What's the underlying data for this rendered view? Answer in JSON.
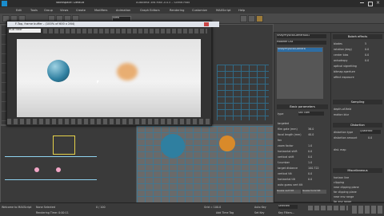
{
  "window": {
    "title": "Autodesk 3ds Max 2015 – Scene.max",
    "tab": "Workspace: Default"
  },
  "menu": [
    "Edit",
    "Tools",
    "Group",
    "Views",
    "Create",
    "Modifiers",
    "Animation",
    "Graph Editors",
    "Rendering",
    "Customize",
    "MAXScript",
    "Help"
  ],
  "toolbar": {
    "view_dropdown": "View"
  },
  "frame_buffer": {
    "title": "F-Top, frame buffer - (100% of 600 x 264)",
    "channel_dropdown": "RGB color"
  },
  "modify_panel": {
    "object_name": "VRayPhysicalCamera001",
    "modifier_list": "Modifier List",
    "stack_item": "VRayPhysicalCamera",
    "rollout_basic": "Basic parameters",
    "type_label": "type",
    "type_value": "Still cam",
    "params": [
      {
        "label": "targeted",
        "value": ""
      },
      {
        "label": "film gate (mm)",
        "value": "36.0"
      },
      {
        "label": "focal length (mm)",
        "value": "40.0"
      },
      {
        "label": "fov",
        "value": ""
      },
      {
        "label": "zoom factor",
        "value": "1.0"
      },
      {
        "label": "horizontal shift",
        "value": "0.0"
      },
      {
        "label": "vertical shift",
        "value": "0.0"
      },
      {
        "label": "f-number",
        "value": "1.0"
      },
      {
        "label": "target distance",
        "value": "100.722"
      },
      {
        "label": "vertical tilt",
        "value": "0.0"
      },
      {
        "label": "horizontal tilt",
        "value": "0.0"
      },
      {
        "label": "auto guess vert tilt",
        "value": ""
      }
    ],
    "guess_vert": "Guess vert tilt",
    "guess_horiz": "Guess horiz tilt"
  },
  "right_panel": {
    "bokeh": "Bokeh effects",
    "bokeh_params": [
      {
        "label": "blades",
        "value": "5"
      },
      {
        "label": "rotation (deg)",
        "value": "0.0"
      },
      {
        "label": "center bias",
        "value": "0.0"
      },
      {
        "label": "anisotropy",
        "value": "0.0"
      }
    ],
    "bokeh_checks": [
      "optical vignetting",
      "bitmap aperture",
      "affect exposure"
    ],
    "sampling": "Sampling",
    "sampling_checks": [
      "depth-of-field",
      "motion blur"
    ],
    "distortion": "Distortion",
    "distortion_type_label": "distortion type",
    "distortion_type": "Quadratic",
    "distortion_amount_label": "distortion amount",
    "distortion_amount": "0.0",
    "dist_map": "dist. map",
    "misc": "Miscellaneous",
    "misc_checks": [
      "horizon line",
      "clipping",
      "near clipping plane",
      "far clipping plane",
      "near env range",
      "far env range"
    ]
  },
  "status": {
    "selection": "None Selected",
    "time": "0 / 100",
    "welcome": "Welcome to MAXScript",
    "render_time": "Rendering Time: 0:00:11",
    "grid": "Grid = 100.0",
    "add_time_tag": "Add Time Tag",
    "auto_key": "Auto Key",
    "selected": "Selected",
    "set_key": "Set Key",
    "key_filters": "Key Filters..."
  },
  "colors": {
    "teal_ball": "#3a8aa0",
    "orange_ball": "#d98a2a",
    "pink_dot": "#f2a6c6"
  }
}
